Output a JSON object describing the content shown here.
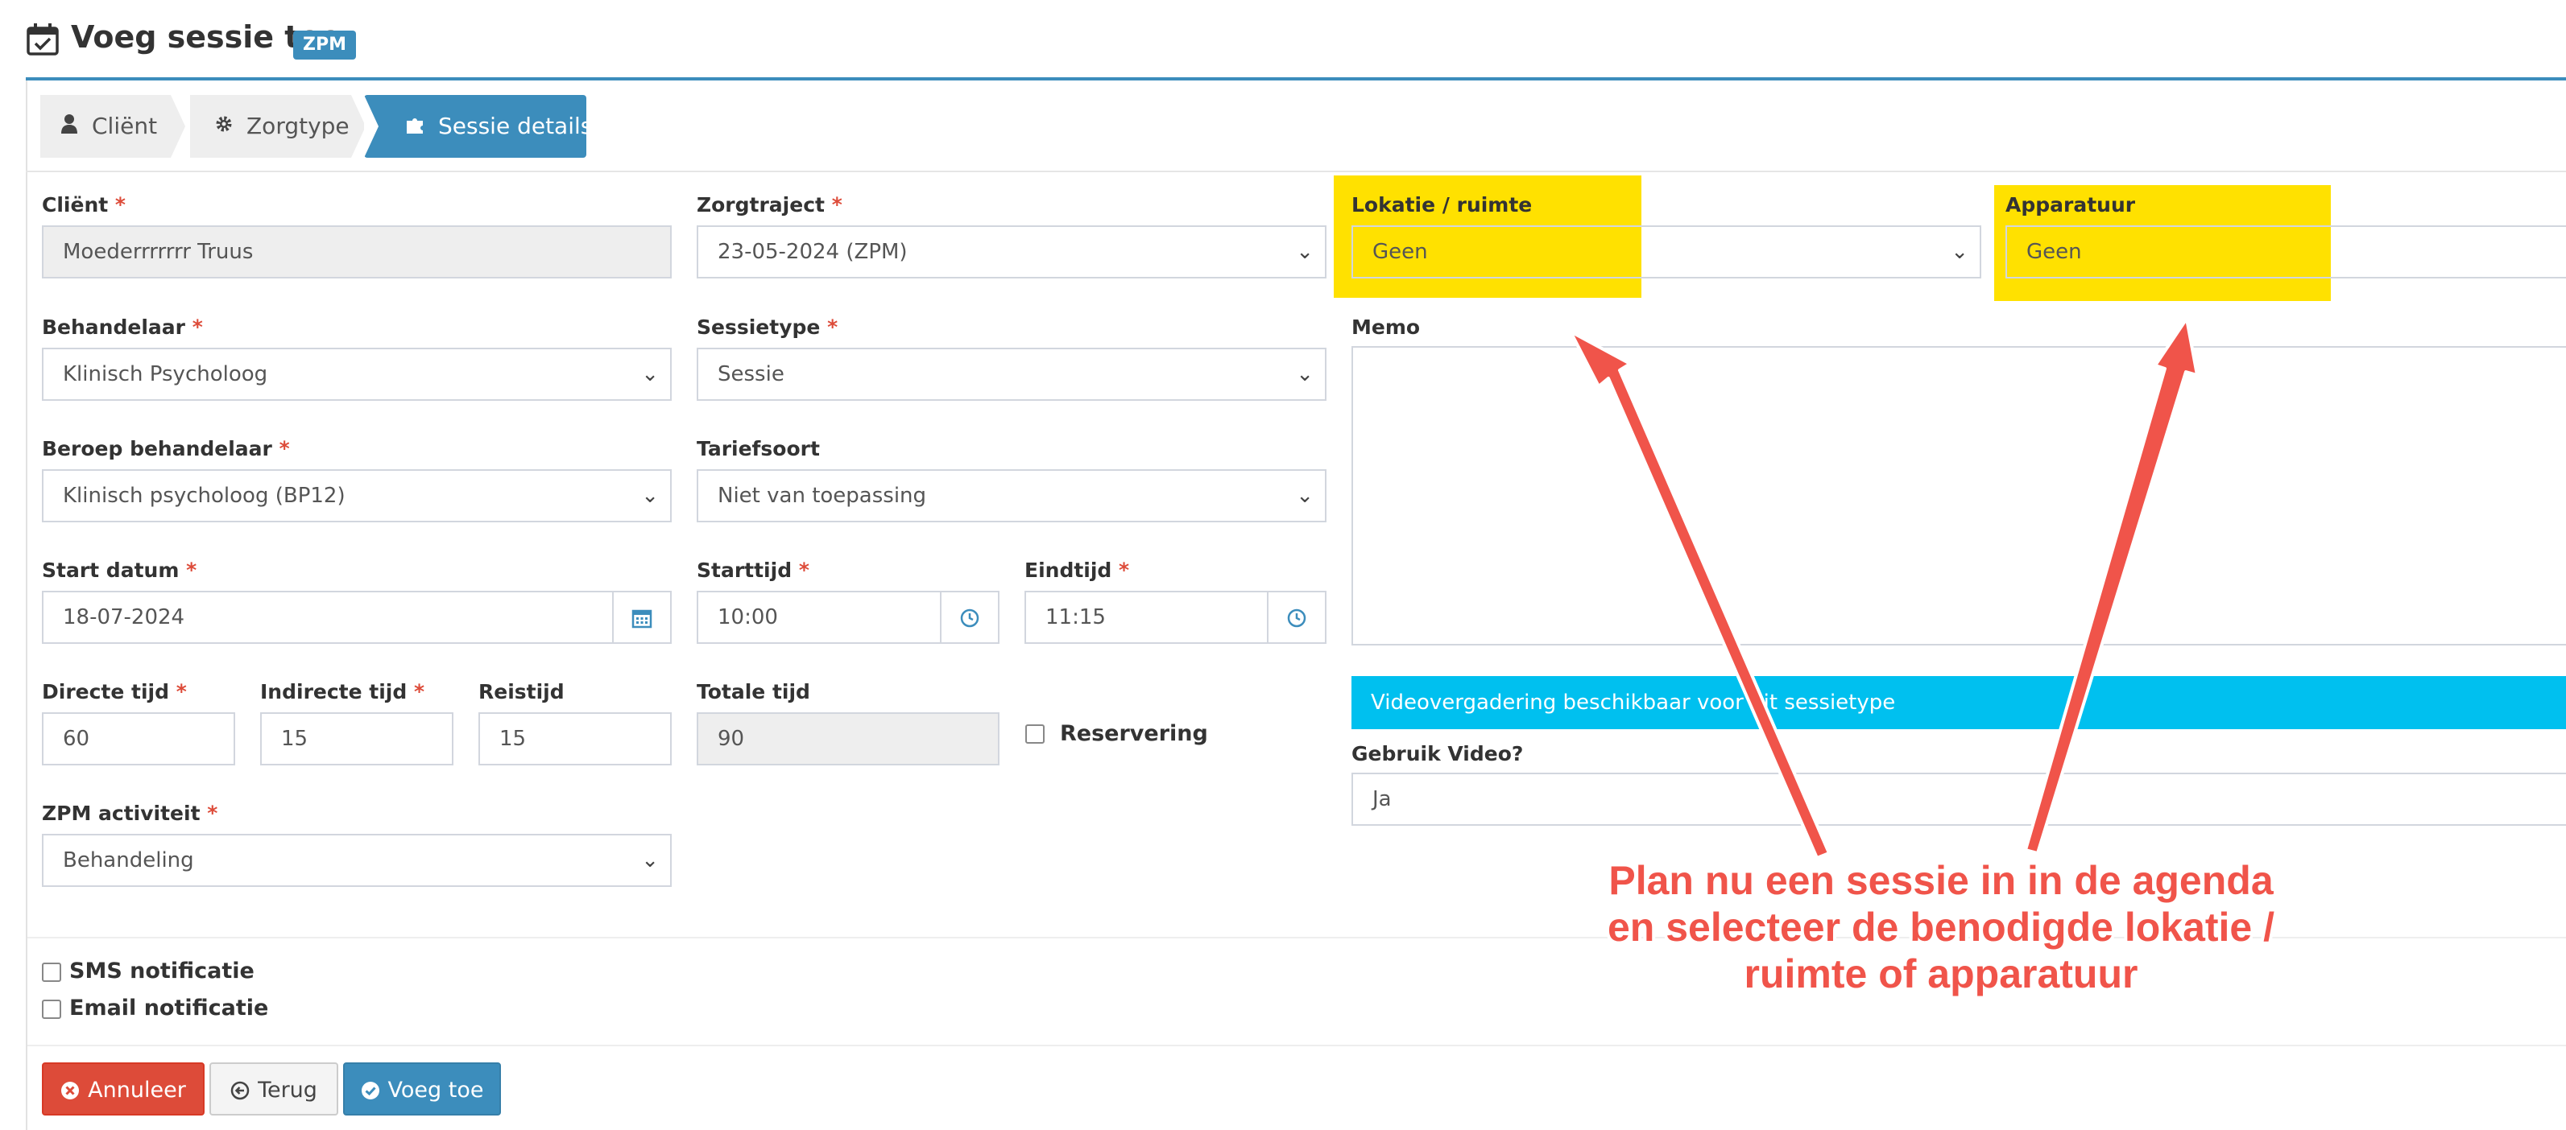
{
  "header": {
    "title": "Voeg sessie toe",
    "badge": "ZPM"
  },
  "wizard": {
    "steps": [
      {
        "label": "Cliënt",
        "icon": "user-icon",
        "state": "done"
      },
      {
        "label": "Zorgtype",
        "icon": "gear-icon",
        "state": "done"
      },
      {
        "label": "Sessie details",
        "icon": "puzzle-icon",
        "state": "active"
      }
    ]
  },
  "form": {
    "client": {
      "label": "Cliënt",
      "value": "Moederrrrrrr Truus"
    },
    "zorgtraject": {
      "label": "Zorgtraject",
      "value": "23-05-2024 (ZPM)"
    },
    "lokatie": {
      "label": "Lokatie / ruimte",
      "value": "Geen"
    },
    "apparatuur": {
      "label": "Apparatuur",
      "value": "Geen"
    },
    "behandelaar": {
      "label": "Behandelaar",
      "value": "Klinisch Psycholoog"
    },
    "sessietype": {
      "label": "Sessietype",
      "value": "Sessie"
    },
    "memo": {
      "label": "Memo",
      "value": ""
    },
    "beroep": {
      "label": "Beroep behandelaar",
      "value": "Klinisch psycholoog (BP12)"
    },
    "tariefsoort": {
      "label": "Tariefsoort",
      "value": "Niet van toepassing"
    },
    "startdatum": {
      "label": "Start datum",
      "value": "18-07-2024"
    },
    "starttijd": {
      "label": "Starttijd",
      "value": "10:00"
    },
    "eindtijd": {
      "label": "Eindtijd",
      "value": "11:15"
    },
    "directe_tijd": {
      "label": "Directe tijd",
      "value": "60"
    },
    "indirecte_tijd": {
      "label": "Indirecte tijd",
      "value": "15"
    },
    "reistijd": {
      "label": "Reistijd",
      "value": "15"
    },
    "totale_tijd": {
      "label": "Totale tijd",
      "value": "90"
    },
    "reservering": {
      "label": "Reservering",
      "checked": false
    },
    "video_notice": "Videovergadering beschikbaar voor dit sessietype",
    "gebruik_video": {
      "label": "Gebruik Video?",
      "value": "Ja"
    },
    "zpm_activiteit": {
      "label": "ZPM activiteit",
      "value": "Behandeling"
    },
    "sms_notificatie": {
      "label": "SMS notificatie",
      "checked": false
    },
    "email_notificatie": {
      "label": "Email notificatie",
      "checked": false
    },
    "required_mark": "*"
  },
  "buttons": {
    "cancel": "Annuleer",
    "back": "Terug",
    "submit": "Voeg toe"
  },
  "annotation": {
    "line1": "Plan nu een sessie in in de agenda",
    "line2": "en selecteer de benodigde lokatie /",
    "line3": "ruimte of apparatuur",
    "color": "#f0544a"
  },
  "colors": {
    "primary": "#3c8dbc",
    "danger": "#dd4b39",
    "info": "#00c0ef",
    "highlight": "#ffe100"
  }
}
